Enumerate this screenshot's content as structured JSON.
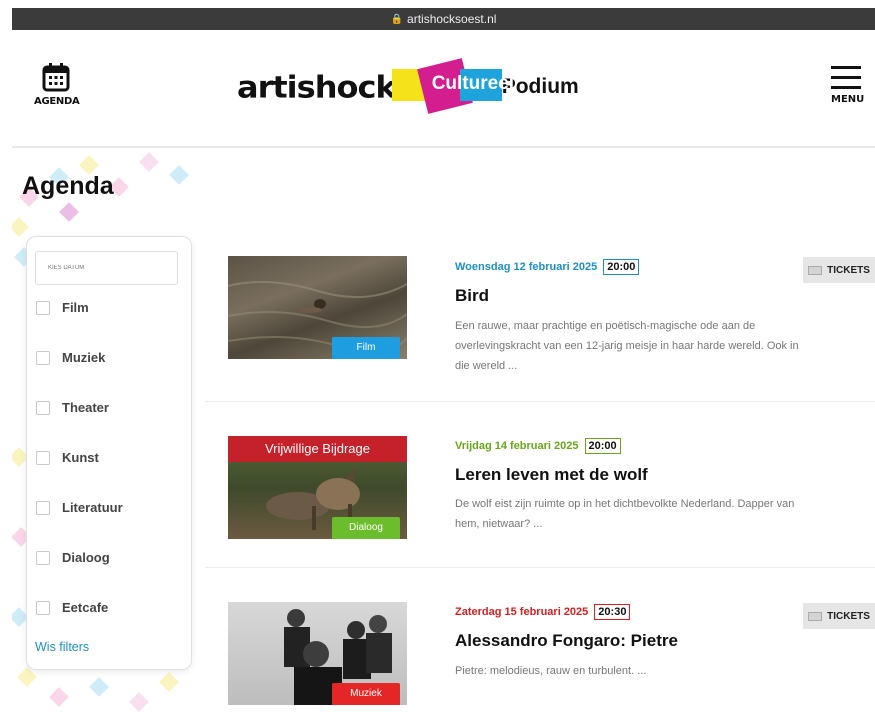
{
  "browser": {
    "url": "artishocksoest.nl"
  },
  "header": {
    "agenda_label": "AGENDA",
    "logo": {
      "word": "artishock",
      "cultureel": "Cultureel",
      "podium": "Podium"
    },
    "menu_label": "MENU"
  },
  "page": {
    "title": "Agenda"
  },
  "filters": {
    "date_placeholder": "KIES DATUM",
    "categories": [
      "Film",
      "Muziek",
      "Theater",
      "Kunst",
      "Literatuur",
      "Dialoog",
      "Eetcafe"
    ],
    "show_filters": "Wis filters"
  },
  "events": [
    {
      "date": "Woensdag 12 februari 2025",
      "time": "20:00",
      "title": "Bird",
      "description": "Een rauwe, maar prachtige en poëtisch-magische ode aan de overlevingskracht van een 12-jarig meisje in haar harde wereld. Ook in die wereld ...",
      "category": "Film",
      "tickets_label": "TICKETS",
      "date_color": "#1e8ec8",
      "tag_color": "#1e9ee0"
    },
    {
      "date": "Vrijdag 14 februari 2025",
      "time": "20:00",
      "title": "Leren leven met de wolf",
      "description": "De wolf eist zijn ruimte op in het dichtbevolkte Nederland. Dapper van hem, nietwaar? ...",
      "category": "Dialoog",
      "banner": "Vrijwillige Bijdrage",
      "date_color": "#6aa51e",
      "tag_color": "#6cbd2c"
    },
    {
      "date": "Zaterdag 15 februari 2025",
      "time": "20:30",
      "title": "Alessandro Fongaro: Pietre",
      "description": "Pietre: melodieus, rauw en turbulent. ...",
      "category": "Muziek",
      "tickets_label": "TICKETS",
      "date_color": "#d42020",
      "tag_color": "#e52626"
    }
  ]
}
